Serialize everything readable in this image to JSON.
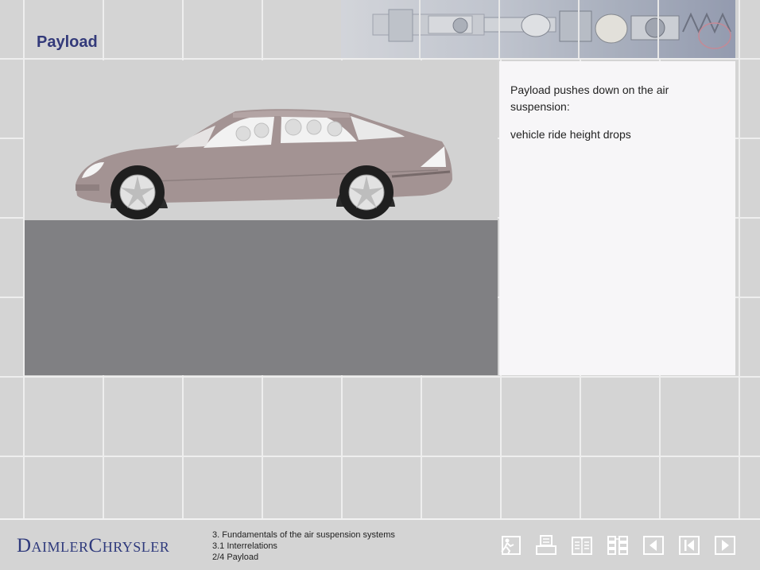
{
  "page": {
    "title": "Payload"
  },
  "info": {
    "paragraphs": [
      "Payload pushes down on the air suspension:",
      "vehicle ride height drops"
    ]
  },
  "footer": {
    "brand": "DaimlerChrysler",
    "breadcrumb": [
      "3. Fundamentals of the air suspension systems",
      "3.1 Interrelations",
      "2/4 Payload"
    ]
  },
  "nav": {
    "buttons": [
      {
        "name": "exit-icon"
      },
      {
        "name": "print-icon"
      },
      {
        "name": "glossary-icon"
      },
      {
        "name": "contents-icon"
      },
      {
        "name": "previous-icon"
      },
      {
        "name": "first-page-icon"
      },
      {
        "name": "next-icon"
      }
    ]
  },
  "colors": {
    "title": "#333a7a",
    "brand": "#2f3a7c",
    "car_body": "#a39393",
    "ground": "#808083",
    "panel": "#f7f6f8"
  }
}
